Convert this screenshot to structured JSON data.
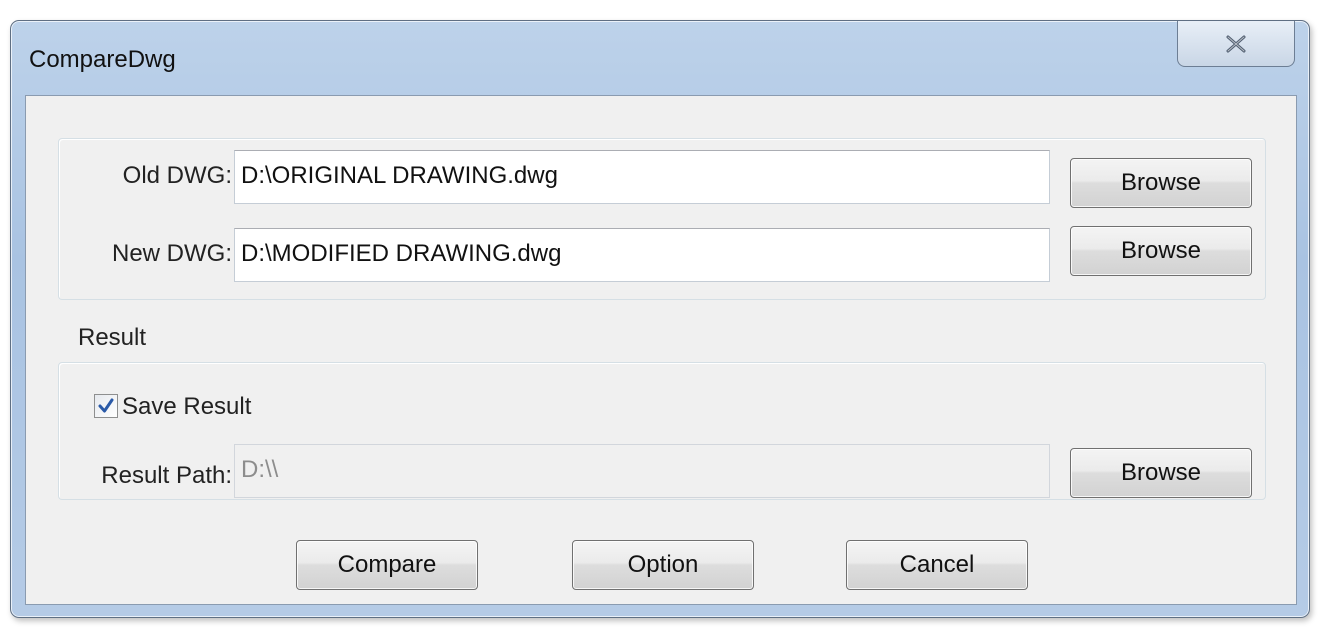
{
  "window": {
    "title": "CompareDwg"
  },
  "inputs": {
    "old_dwg_label": "Old DWG:",
    "old_dwg_value": "D:\\ORIGINAL DRAWING.dwg",
    "new_dwg_label": "New DWG:",
    "new_dwg_value": "D:\\MODIFIED DRAWING.dwg",
    "browse_label": "Browse"
  },
  "result": {
    "group_label": "Result",
    "save_result_label": "Save Result",
    "save_result_checked": true,
    "result_path_label": "Result Path:",
    "result_path_value": "D:\\\\"
  },
  "actions": {
    "compare_label": "Compare",
    "option_label": "Option",
    "cancel_label": "Cancel"
  },
  "icons": {
    "close": "close-icon",
    "check": "checkmark-icon"
  },
  "colors": {
    "title_bar": "#b5cbe6",
    "client_bg": "#f0f0f0",
    "checkmark": "#2a5aa8"
  }
}
